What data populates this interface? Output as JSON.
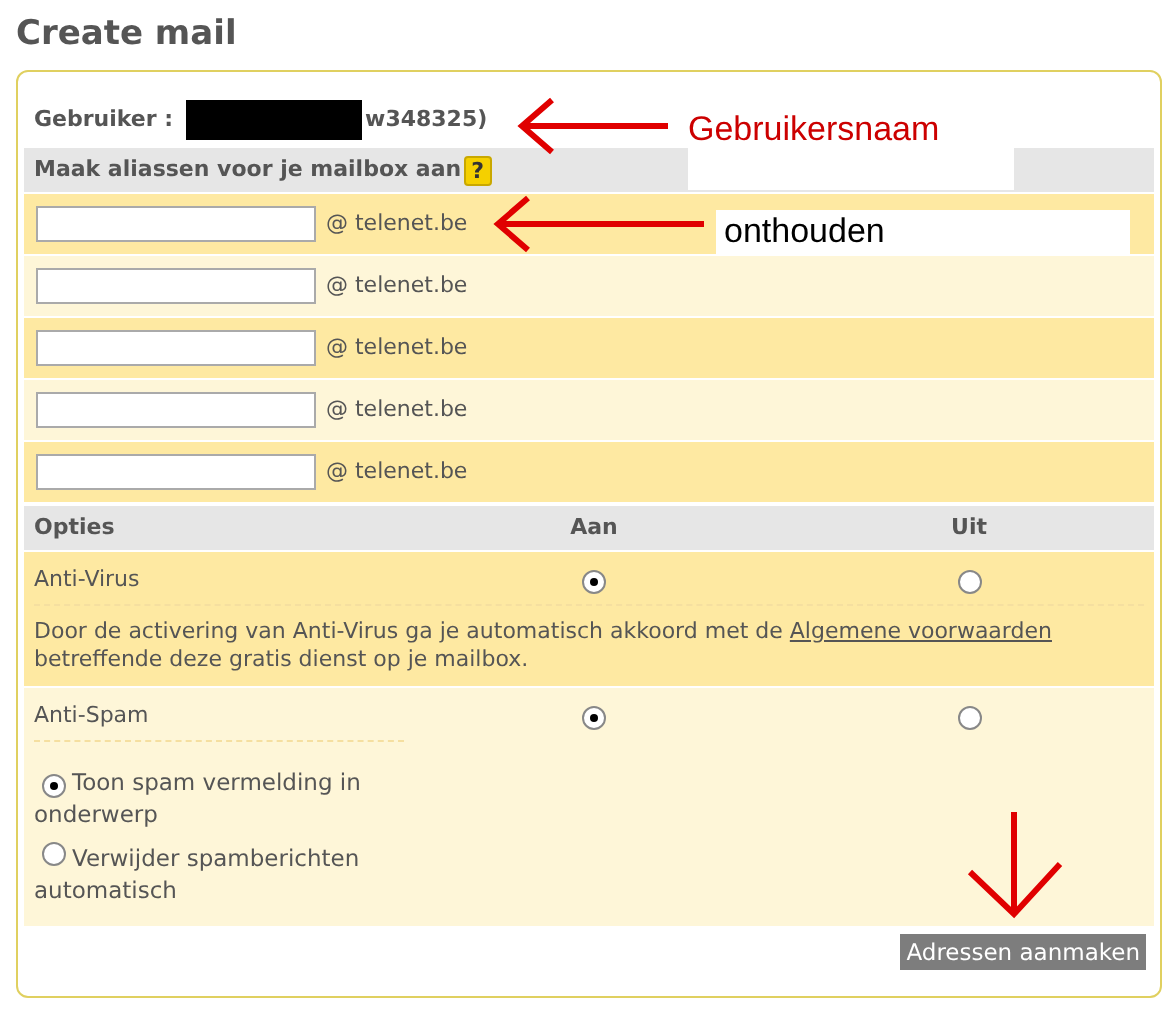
{
  "title": "Create mail",
  "user": {
    "label": "Gebruiker :",
    "value": "w348325)"
  },
  "alias_header": {
    "label": "Maak aliassen voor je mailbox aan",
    "help": "?"
  },
  "aliases": [
    {
      "domain": "@ telenet.be"
    },
    {
      "domain": "@ telenet.be"
    },
    {
      "domain": "@ telenet.be"
    },
    {
      "domain": "@ telenet.be"
    },
    {
      "domain": "@ telenet.be"
    }
  ],
  "options_columns": [
    "Opties",
    "Aan",
    "Uit"
  ],
  "options": [
    {
      "name": "Anti-Virus",
      "choices": [
        {
          "selected": true
        },
        {
          "selected": false
        }
      ],
      "note": "Door de activering van Anti-Virus ga je automatisch akkoord met de",
      "link": "Algemene voorwaarden",
      "note_end": "betreffende deze gratis dienst op je mailbox."
    },
    {
      "name": "Anti-Spam",
      "choices": [
        {
          "selected": true
        },
        {
          "selected": false
        }
      ],
      "modes": [
        {
          "label": "Toon spam vermelding in onderwerp",
          "selected": true
        },
        {
          "label": "Verwijder spamberichten automatisch",
          "selected": false
        }
      ]
    }
  ],
  "button": "Adressen aanmaken",
  "annotations": [
    {
      "text": "Gebruikersnaam"
    },
    {
      "text": "onthouden"
    }
  ]
}
